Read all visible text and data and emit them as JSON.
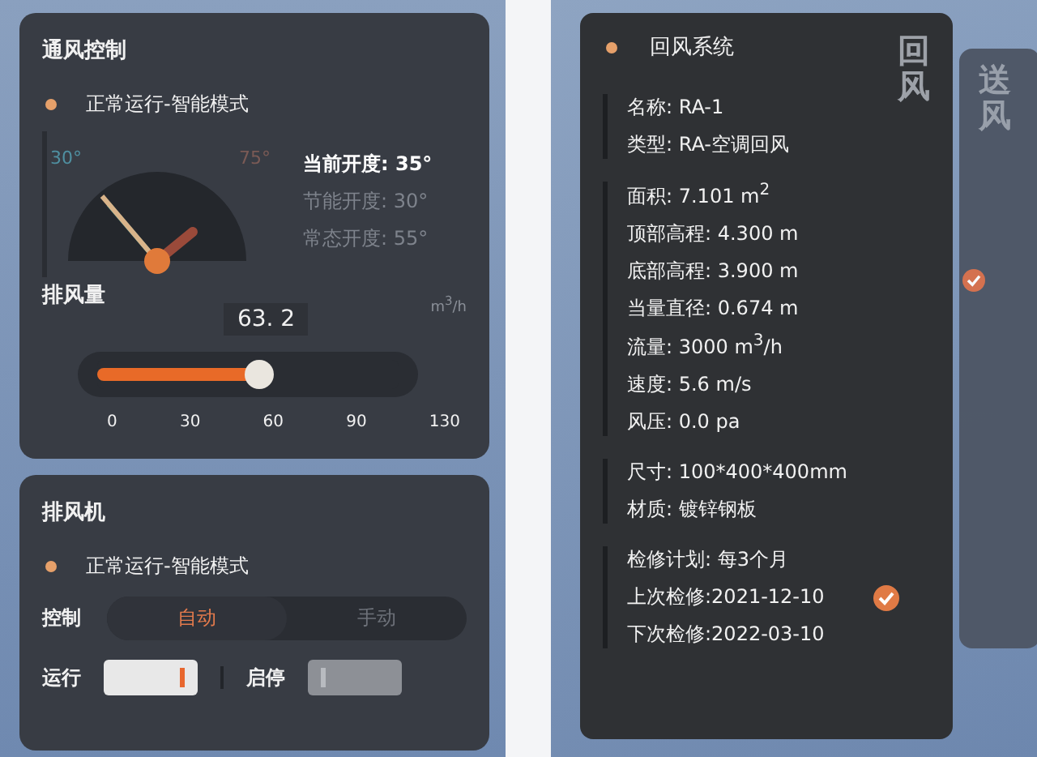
{
  "ventilation": {
    "title": "通风控制",
    "status": "正常运行-智能模式",
    "gauge": {
      "min_label": "30°",
      "max_label": "75°"
    },
    "readings": [
      {
        "text": "当前开度: 35°",
        "kind": "current"
      },
      {
        "text": "节能开度: 30°",
        "kind": "dim"
      },
      {
        "text": "常态开度: 55°",
        "kind": "dim"
      }
    ],
    "exhaust": {
      "label": "排风量",
      "unit": "m$^{3}$/h",
      "value": "63. 2",
      "level": 0.54,
      "ticks": [
        "0",
        "30",
        "60",
        "90",
        "130"
      ]
    }
  },
  "fan": {
    "title": "排风机",
    "status": "正常运行-智能模式",
    "control_label": "控制",
    "modes": [
      {
        "label": "自动",
        "selected": true
      },
      {
        "label": "手动",
        "selected": false
      }
    ],
    "switches": [
      {
        "label": "运行",
        "on": true
      },
      {
        "label": "启停",
        "on": false
      }
    ]
  },
  "return_air": {
    "title": "回风系统",
    "side_label": "回风",
    "groups": [
      [
        {
          "text": "名称: RA-1"
        },
        {
          "text": "类型: RA-空调回风"
        }
      ],
      [
        {
          "text": "面积: 7.101 m$^{2}$"
        },
        {
          "text": "顶部高程: 4.300 m"
        },
        {
          "text": "底部高程: 3.900 m"
        },
        {
          "text": "当量直径: 0.674 m"
        },
        {
          "text": "流量: 3000 m$^{3}$/h"
        },
        {
          "text": "速度: 5.6 m/s"
        },
        {
          "text": "风压: 0.0 pa"
        }
      ],
      [
        {
          "text": "尺寸: 100*400*400mm"
        },
        {
          "text": "材质: 镀锌钢板"
        }
      ],
      [
        {
          "text": "检修计划: 每3个月",
          "checked": false
        },
        {
          "text": "上次检修:2021-12-10",
          "checked": true
        },
        {
          "text": "下次检修:2022-03-10",
          "checked": false
        }
      ]
    ]
  },
  "supply_air": {
    "side_label": "送风",
    "checked": true
  }
}
